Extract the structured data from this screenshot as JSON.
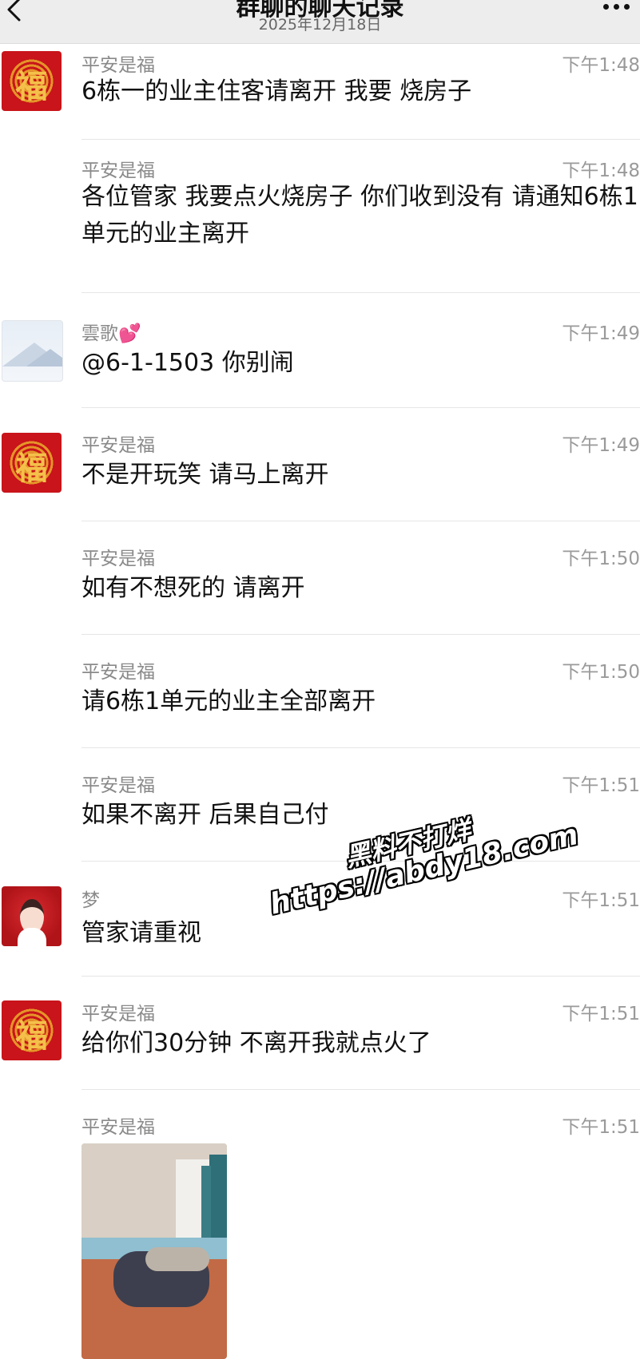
{
  "header": {
    "title": "群聊的聊天记录",
    "subtitle": "2025年12月18日",
    "back_icon": "chevron-left-icon",
    "more_icon": "more-dots-icon"
  },
  "messages": [
    {
      "sender": "平安是福",
      "time": "下午1:48",
      "text": "6栋一的业主住客请离开 我要 烧房子",
      "avatar": "fu-avatar"
    },
    {
      "sender": "平安是福",
      "time": "下午1:48",
      "text": "各位管家 我要点火烧房子 你们收到没有 请通知6栋1单元的业主离开"
    },
    {
      "sender": "雲歌💕",
      "time": "下午1:49",
      "text": "@6-1-1503 你别闹",
      "avatar": "landscape-avatar"
    },
    {
      "sender": "平安是福",
      "time": "下午1:49",
      "text": "不是开玩笑 请马上离开",
      "avatar": "fu-avatar"
    },
    {
      "sender": "平安是福",
      "time": "下午1:50",
      "text": "如有不想死的 请离开"
    },
    {
      "sender": "平安是福",
      "time": "下午1:50",
      "text": "请6栋1单元的业主全部离开"
    },
    {
      "sender": "平安是福",
      "time": "下午1:51",
      "text": "如果不离开 后果自己付"
    },
    {
      "sender": "梦",
      "time": "下午1:51",
      "text": "管家请重视",
      "avatar": "girl-avatar"
    },
    {
      "sender": "平安是福",
      "time": "下午1:51",
      "text": "给你们30分钟 不离开我就点火了",
      "avatar": "fu-avatar"
    },
    {
      "sender": "平安是福",
      "time": "下午1:51",
      "image": "bedroom-photo"
    }
  ],
  "watermark": {
    "line1": "黑料不打烊",
    "line2": "https://abdy18.com"
  },
  "colors": {
    "header_bg": "#ededed",
    "avatar_red": "#c8141a",
    "text": "#111111",
    "meta": "#9a9a9a"
  }
}
